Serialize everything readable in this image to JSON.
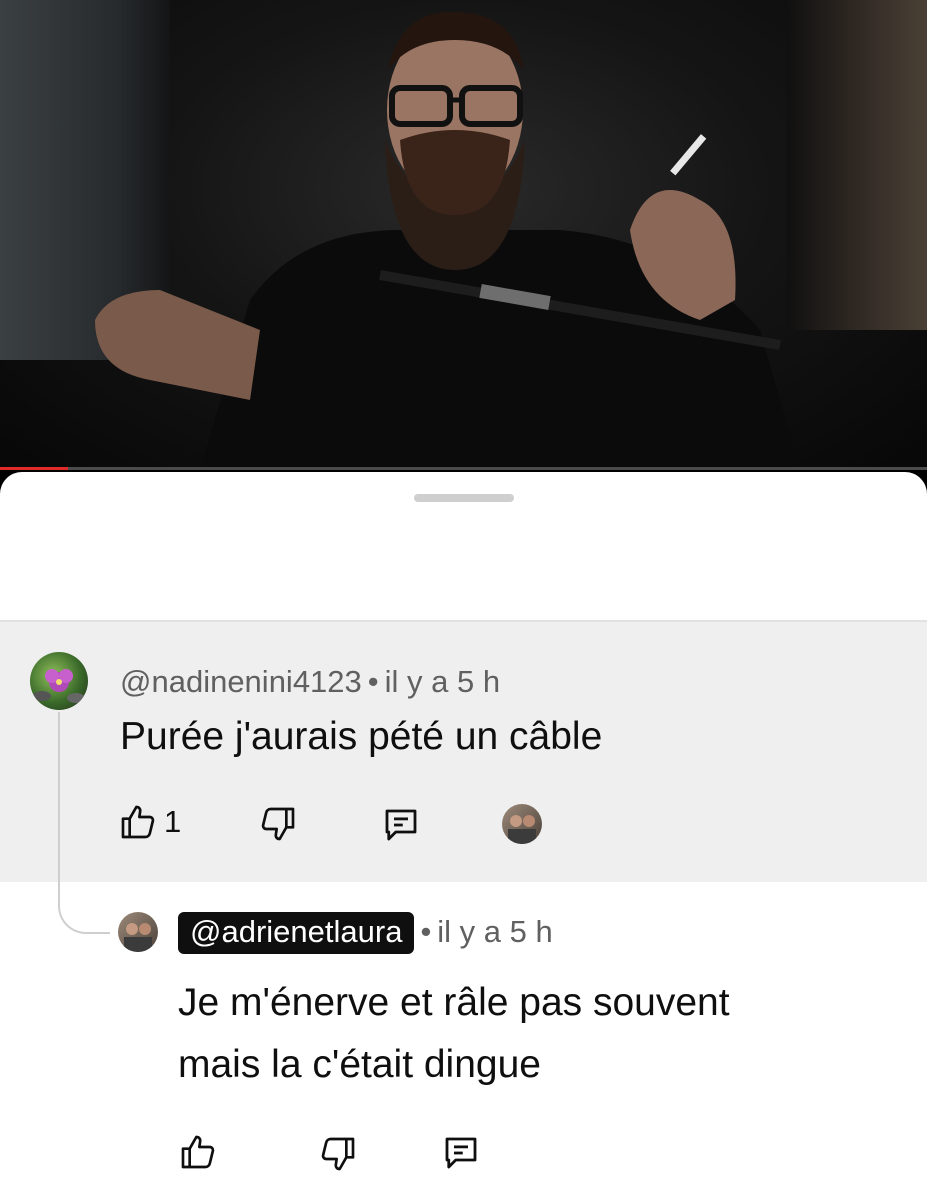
{
  "video": {
    "progress_fraction": 0.073,
    "progress_color": "#e12a2a"
  },
  "comments": [
    {
      "author": "@nadinenini4123",
      "separator": "•",
      "time": "il y a 5 h",
      "text": "Purée j'aurais pété un câble",
      "likes": "1",
      "icons": [
        "thumbs-up-icon",
        "thumbs-down-icon",
        "reply-icon",
        "creator-heart-avatar"
      ],
      "highlighted": true
    }
  ],
  "reply": {
    "author": "@adrienetlaura",
    "separator": "•",
    "time": "il y a 5 h",
    "text_line1": "Je m'énerve et râle pas souvent",
    "text_line2": "mais la c'était dingue",
    "icons": [
      "thumbs-up-icon",
      "thumbs-down-icon",
      "reply-icon"
    ]
  },
  "colors": {
    "highlight_bg": "#efefef",
    "meta_text": "#606060",
    "chip_bg": "#0f0f0f"
  }
}
